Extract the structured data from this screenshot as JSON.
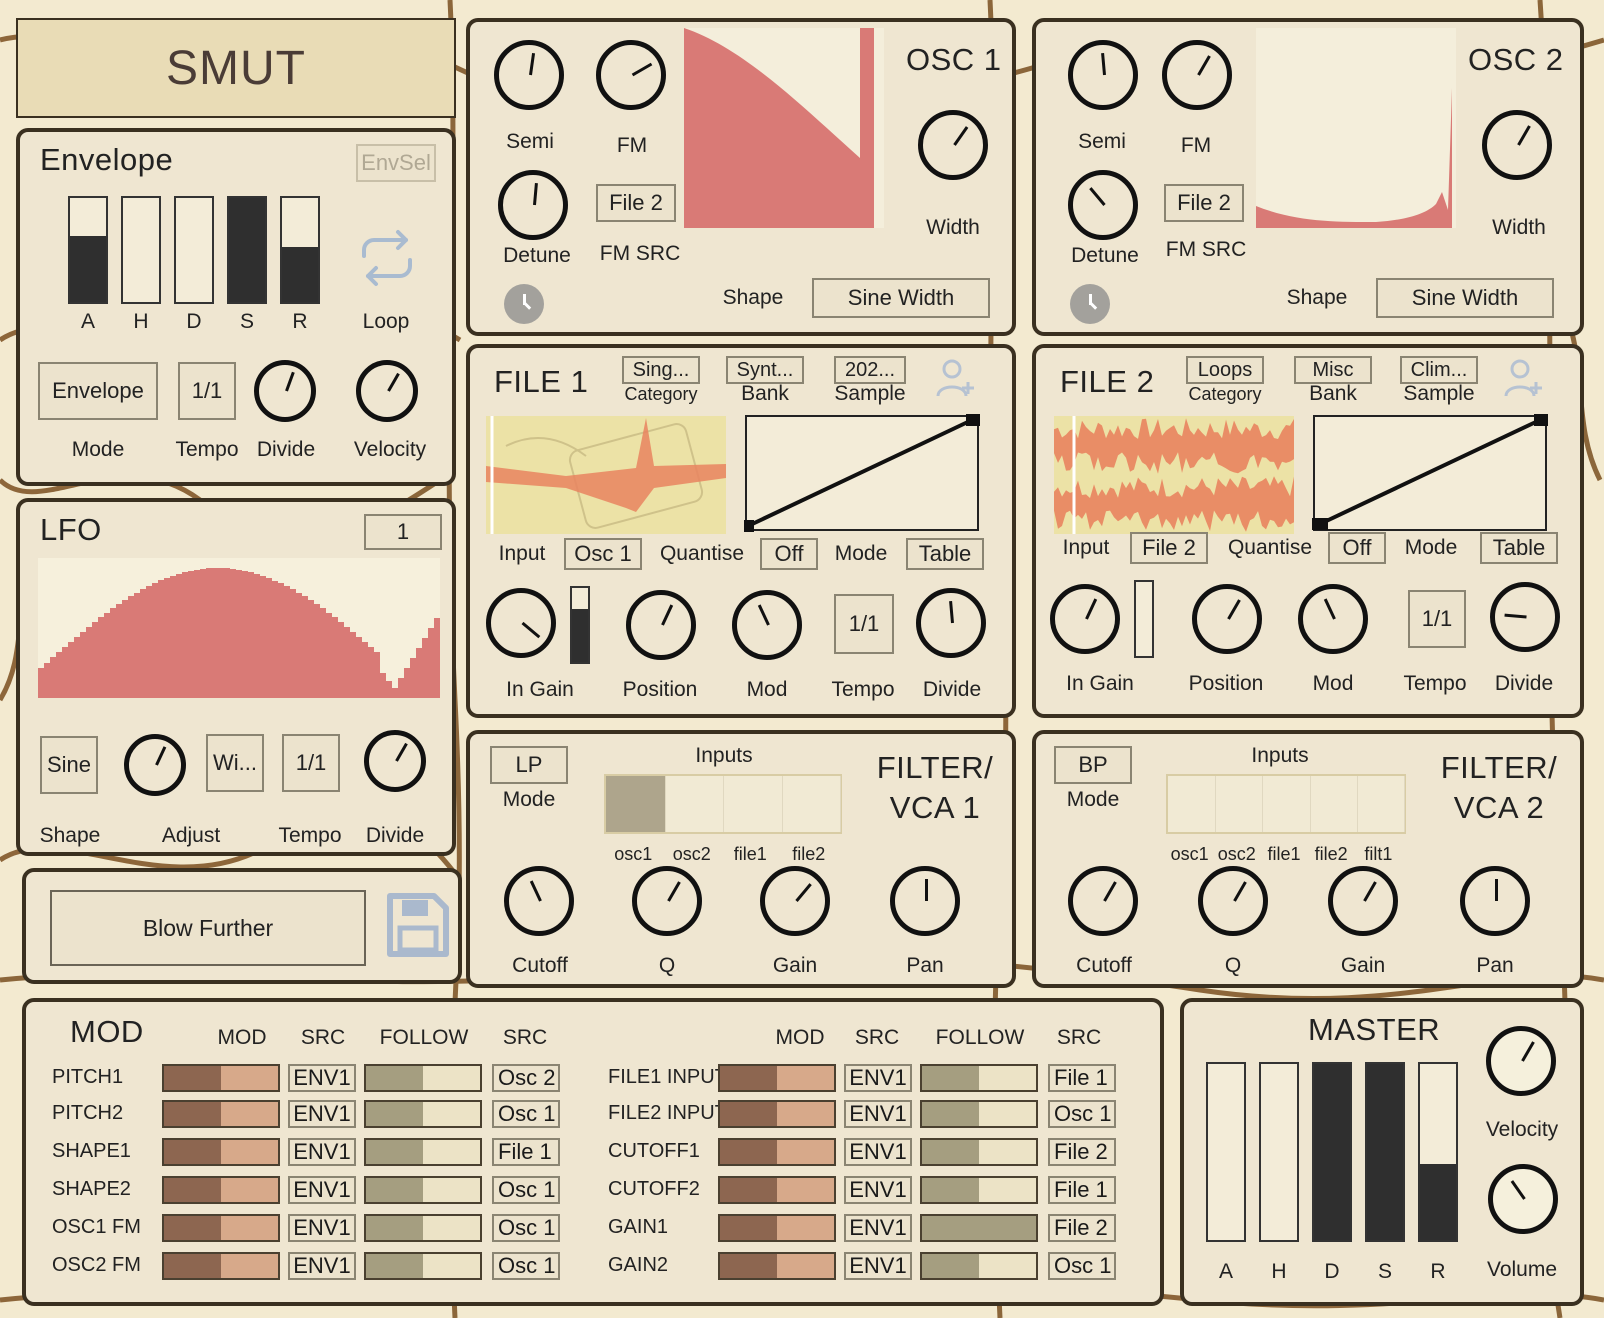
{
  "logo": {
    "text": "SMUT"
  },
  "envelope": {
    "title": "Envelope",
    "envsel": "EnvSel",
    "sliders": [
      {
        "label": "A",
        "level": 0.63
      },
      {
        "label": "H",
        "level": 0
      },
      {
        "label": "D",
        "level": 0
      },
      {
        "label": "S",
        "level": 1
      },
      {
        "label": "R",
        "level": 0.53
      }
    ],
    "loop_label": "Loop",
    "mode_btn": "Envelope",
    "tempo_btn": "1/1",
    "labels": {
      "mode": "Mode",
      "tempo": "Tempo",
      "divide": "Divide",
      "velocity": "Velocity"
    }
  },
  "lfo": {
    "title": "LFO",
    "number": "1",
    "shape_btn": "Sine",
    "wi_btn": "Wi...",
    "tempo_btn": "1/1",
    "labels": {
      "shape": "Shape",
      "adjust": "Adjust",
      "tempo": "Tempo",
      "divide": "Divide"
    }
  },
  "preset": {
    "name": "Blow Further"
  },
  "osc1": {
    "title": "OSC 1",
    "semi": "Semi",
    "fm": "FM",
    "detune": "Detune",
    "fmsrc_btn": "File 2",
    "fmsrc": "FM SRC",
    "width": "Width",
    "shape": "Shape",
    "shape_btn": "Sine Width"
  },
  "osc2": {
    "title": "OSC 2",
    "semi": "Semi",
    "fm": "FM",
    "detune": "Detune",
    "fmsrc_btn": "File 2",
    "fmsrc": "FM SRC",
    "width": "Width",
    "shape": "Shape",
    "shape_btn": "Sine Width"
  },
  "file1": {
    "title": "FILE 1",
    "category_btn": "Sing...",
    "category": "Category",
    "bank_btn": "Synt...",
    "bank": "Bank",
    "sample_btn": "202...",
    "sample": "Sample",
    "input": "Input",
    "input_btn": "Osc 1",
    "quantise": "Quantise",
    "quantise_btn": "Off",
    "mode": "Mode",
    "mode_btn": "Table",
    "ingain": "In Gain",
    "ingain_level": 0.72,
    "position": "Position",
    "mod": "Mod",
    "tempo_btn": "1/1",
    "tempo": "Tempo",
    "divide": "Divide"
  },
  "file2": {
    "title": "FILE 2",
    "category_btn": "Loops",
    "category": "Category",
    "bank_btn": "Misc",
    "bank": "Bank",
    "sample_btn": "Clim...",
    "sample": "Sample",
    "input": "Input",
    "input_btn": "File 2",
    "quantise": "Quantise",
    "quantise_btn": "Off",
    "mode": "Mode",
    "mode_btn": "Table",
    "ingain": "In Gain",
    "ingain_level": 0,
    "position": "Position",
    "mod": "Mod",
    "tempo_btn": "1/1",
    "tempo": "Tempo",
    "divide": "Divide"
  },
  "filter1": {
    "title1": "FILTER/",
    "title2": "VCA 1",
    "mode_btn": "LP",
    "mode": "Mode",
    "inputs": "Inputs",
    "input_names": [
      "osc1",
      "osc2",
      "file1",
      "file2"
    ],
    "input_active": [
      true,
      false,
      false,
      false
    ],
    "cutoff": "Cutoff",
    "q": "Q",
    "gain": "Gain",
    "pan": "Pan"
  },
  "filter2": {
    "title1": "FILTER/",
    "title2": "VCA 2",
    "mode_btn": "BP",
    "mode": "Mode",
    "inputs": "Inputs",
    "input_names": [
      "osc1",
      "osc2",
      "file1",
      "file2",
      "filt1"
    ],
    "input_active": [
      false,
      false,
      false,
      false,
      false
    ],
    "cutoff": "Cutoff",
    "q": "Q",
    "gain": "Gain",
    "pan": "Pan"
  },
  "mod": {
    "title": "MOD",
    "headers": {
      "mod": "MOD",
      "src": "SRC",
      "follow": "FOLLOW",
      "src2": "SRC"
    },
    "left_rows": [
      {
        "name": "PITCH1",
        "src": "ENV1",
        "follow_src": "Osc 2",
        "follow_level": 0.5
      },
      {
        "name": "PITCH2",
        "src": "ENV1",
        "follow_src": "Osc 1",
        "follow_level": 0.5
      },
      {
        "name": "SHAPE1",
        "src": "ENV1",
        "follow_src": "File 1",
        "follow_level": 0.5
      },
      {
        "name": "SHAPE2",
        "src": "ENV1",
        "follow_src": "Osc 1",
        "follow_level": 0.5
      },
      {
        "name": "OSC1 FM",
        "src": "ENV1",
        "follow_src": "Osc 1",
        "follow_level": 0.5
      },
      {
        "name": "OSC2 FM",
        "src": "ENV1",
        "follow_src": "Osc 1",
        "follow_level": 0.5
      }
    ],
    "right_rows": [
      {
        "name": "FILE1 INPUT",
        "src": "ENV1",
        "follow_src": "File 1",
        "follow_level": 0.5
      },
      {
        "name": "FILE2 INPUT",
        "src": "ENV1",
        "follow_src": "Osc 1",
        "follow_level": 0.5
      },
      {
        "name": "CUTOFF1",
        "src": "ENV1",
        "follow_src": "File 2",
        "follow_level": 0.5
      },
      {
        "name": "CUTOFF2",
        "src": "ENV1",
        "follow_src": "File 1",
        "follow_level": 0.5
      },
      {
        "name": "GAIN1",
        "src": "ENV1",
        "follow_src": "File 2",
        "follow_level": 1
      },
      {
        "name": "GAIN2",
        "src": "ENV1",
        "follow_src": "Osc 1",
        "follow_level": 0.5
      }
    ]
  },
  "master": {
    "title": "MASTER",
    "sliders": [
      {
        "label": "A",
        "level": 0
      },
      {
        "label": "H",
        "level": 0
      },
      {
        "label": "D",
        "level": 1
      },
      {
        "label": "S",
        "level": 1
      },
      {
        "label": "R",
        "level": 0.43
      }
    ],
    "velocity": "Velocity",
    "volume": "Volume"
  },
  "colors": {
    "accent": "#d97a76",
    "panel": "#efe6d1",
    "border": "#3a3020"
  }
}
